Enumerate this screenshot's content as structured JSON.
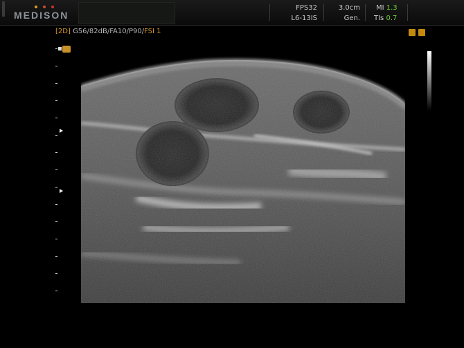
{
  "header": {
    "brand": "MEDISON",
    "fps": "FPS32",
    "probe": "L6-13IS",
    "depth": "3.0cm",
    "preset": "Gen.",
    "mi_label": "MI",
    "mi_value": "1.3",
    "tis_label": "TIs",
    "tis_value": "0.7"
  },
  "params": {
    "mode": "[2D]",
    "settings": "G56/82dB/FA10/P90/",
    "fsi": "FSI 1"
  },
  "colors": {
    "accent_orange": "#d89b2c",
    "value_green": "#6fce3a",
    "text_gray": "#c9c9c9"
  },
  "icons": {
    "top_right": [
      "auto-optimize-icon",
      "settings-icon"
    ]
  }
}
